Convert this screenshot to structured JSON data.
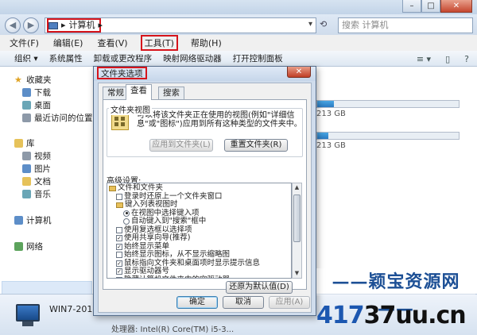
{
  "window": {
    "system_buttons": [
      "–",
      "□",
      "✕"
    ]
  },
  "address_bar": {
    "back_icon": "back-arrow-icon",
    "forward_icon": "forward-arrow-icon",
    "breadcrumb_arrow": "▸",
    "breadcrumb": "计算机",
    "breadcrumb_trailing": "▸",
    "dropdown": "▾",
    "refresh": "⟲",
    "search_placeholder": "搜索 计算机"
  },
  "menu": {
    "items": [
      "文件(F)",
      "编辑(E)",
      "查看(V)",
      "工具(T)",
      "帮助(H)"
    ]
  },
  "command_bar": {
    "items": [
      "组织 ▾",
      "系统属性",
      "卸载或更改程序",
      "映射网络驱动器",
      "打开控制面板"
    ],
    "right_icons": [
      "≡ ▾",
      "▯",
      "?"
    ]
  },
  "nav_pane": {
    "favorites": "收藏夹",
    "favorites_items": [
      "下载",
      "桌面",
      "最近访问的位置"
    ],
    "libraries": "库",
    "libraries_items": [
      "视频",
      "图片",
      "文档",
      "音乐"
    ],
    "computer": "计算机",
    "network": "网络"
  },
  "content": {
    "drives": [
      {
        "text": "213 GB",
        "used_fraction": 0.12
      },
      {
        "text": "213 GB",
        "used_fraction": 0.08
      },
      {
        "text": "213 GB",
        "used_fraction": 0.1
      }
    ]
  },
  "details": {
    "computer_name": "WIN7-201304",
    "processor": "处理器: Intel(R) Core(TM) i5-3..."
  },
  "dialog": {
    "title": "文件夹选项",
    "close": "✕",
    "tabs": [
      "常规",
      "查看",
      "搜索"
    ],
    "folder_views_title": "文件夹视图",
    "folder_views_desc": "可以将该文件夹正在使用的视图(例如\"详细信息\"或\"图标\")应用到所有这种类型的文件夹中。",
    "apply_to_folders": "应用到文件夹(L)",
    "reset_folders": "重置文件夹(R)",
    "advanced_label": "高级设置:",
    "tree": [
      {
        "type": "folder",
        "indent": 0,
        "text": "文件和文件夹"
      },
      {
        "type": "check",
        "indent": 1,
        "checked": false,
        "text": "登录时还原上一个文件夹窗口"
      },
      {
        "type": "folder",
        "indent": 1,
        "text": "键入列表视图时"
      },
      {
        "type": "radio",
        "indent": 2,
        "checked": true,
        "text": "在视图中选择键入项"
      },
      {
        "type": "radio",
        "indent": 2,
        "checked": false,
        "text": "自动键入到\"搜索\"框中"
      },
      {
        "type": "check",
        "indent": 1,
        "checked": false,
        "text": "使用复选框以选择项"
      },
      {
        "type": "check",
        "indent": 1,
        "checked": true,
        "text": "使用共享向导(推荐)"
      },
      {
        "type": "check",
        "indent": 1,
        "checked": true,
        "text": "始终显示菜单"
      },
      {
        "type": "check",
        "indent": 1,
        "checked": false,
        "text": "始终显示图标，从不显示缩略图"
      },
      {
        "type": "check",
        "indent": 1,
        "checked": true,
        "text": "鼠标指向文件夹和桌面项时显示提示信息"
      },
      {
        "type": "check",
        "indent": 1,
        "checked": true,
        "text": "显示驱动器号"
      },
      {
        "type": "check",
        "indent": 1,
        "checked": true,
        "text": "隐藏计算机文件夹中的空驱动器"
      },
      {
        "type": "check",
        "indent": 1,
        "checked": true,
        "text": "隐藏受保护的操作系统文件(推荐)"
      }
    ],
    "restore_defaults": "还原为默认值(D)",
    "ok": "确定",
    "cancel": "取消",
    "apply": "应用(A)"
  },
  "watermark": {
    "line1": "——颖宝资源网——",
    "line2_a": "417",
    "line2_b": "37uu.cn"
  }
}
